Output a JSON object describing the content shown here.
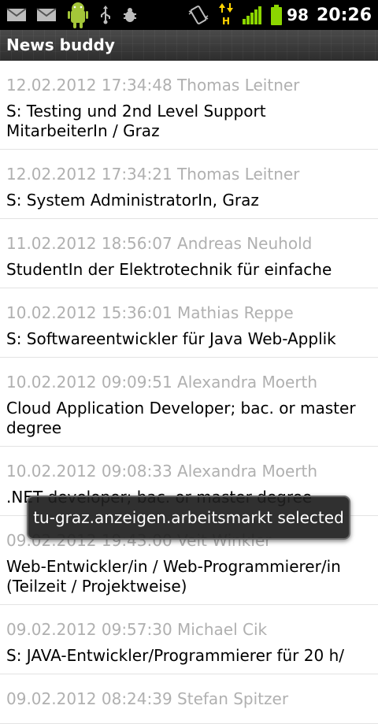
{
  "status_bar": {
    "left_icons": [
      "gmail-icon",
      "mail-icon",
      "android-debug-icon",
      "usb-icon",
      "bug-icon"
    ],
    "right_icons": [
      "vibrate-icon",
      "hspa-data-icon",
      "signal-bars-icon",
      "battery-icon"
    ],
    "battery_percent": "98",
    "time": "20:26",
    "colors": {
      "signal": "#8cd600",
      "data_arrow": "#ffd400",
      "android": "#a4c639"
    }
  },
  "title_bar": {
    "title": "News buddy"
  },
  "items": [
    {
      "meta": "12.02.2012 17:34:48 Thomas Leitner",
      "subject": "S: Testing und 2nd Level Support MitarbeiterIn / Graz"
    },
    {
      "meta": "12.02.2012 17:34:21 Thomas Leitner",
      "subject": "S: System AdministratorIn, Graz"
    },
    {
      "meta": "11.02.2012 18:56:07 Andreas Neuhold",
      "subject": "StudentIn der Elektrotechnik für einfache"
    },
    {
      "meta": "10.02.2012 15:36:01 Mathias Reppe",
      "subject": "S: Softwareentwickler für Java Web-Applik"
    },
    {
      "meta": "10.02.2012 09:09:51 Alexandra Moerth",
      "subject": "Cloud Application Developer; bac. or master degree"
    },
    {
      "meta": "10.02.2012 09:08:33 Alexandra Moerth",
      "subject": ".NET developer; bac. or master degree"
    },
    {
      "meta": "09.02.2012 19:43:00 Veit Winkler",
      "subject": "Web-Entwickler/in / Web-Programmierer/in (Teilzeit / Projektweise)"
    },
    {
      "meta": "09.02.2012 09:57:30 Michael Cik",
      "subject": "S: JAVA-Entwickler/Programmierer für 20 h/"
    },
    {
      "meta": "09.02.2012 08:24:39 Stefan Spitzer",
      "subject": ""
    }
  ],
  "toast": {
    "text": "tu-graz.anzeigen.arbeitsmarkt selected"
  }
}
